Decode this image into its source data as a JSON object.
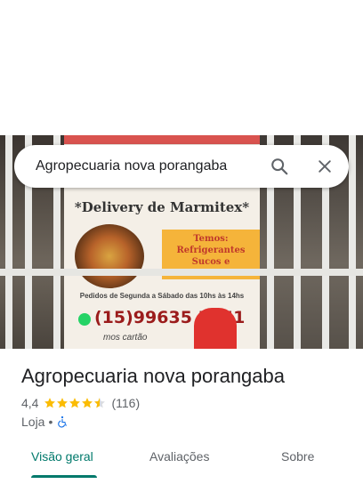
{
  "search": {
    "query": "Agropecuaria nova porangaba"
  },
  "photo": {
    "poster_title": "*Delivery de Marmitex*",
    "promo_lines": [
      "Temos:",
      "Refrigerantes",
      "Sucos e Sobremesas"
    ],
    "hours": "Pedidos de Segunda a Sábado das 10hs às 14hs",
    "phone": "(15)99635 5251",
    "card": "mos cartão"
  },
  "place": {
    "name": "Agropecuaria nova porangaba",
    "rating": "4,4",
    "stars_value": 4.4,
    "review_count": "(116)",
    "category": "Loja",
    "separator": "•"
  },
  "tabs": [
    {
      "label": "Visão geral",
      "active": true
    },
    {
      "label": "Avaliações",
      "active": false
    },
    {
      "label": "Sobre",
      "active": false
    }
  ],
  "colors": {
    "accent": "#00796b",
    "star": "#fbbc04",
    "wheelchair": "#1a73e8"
  }
}
